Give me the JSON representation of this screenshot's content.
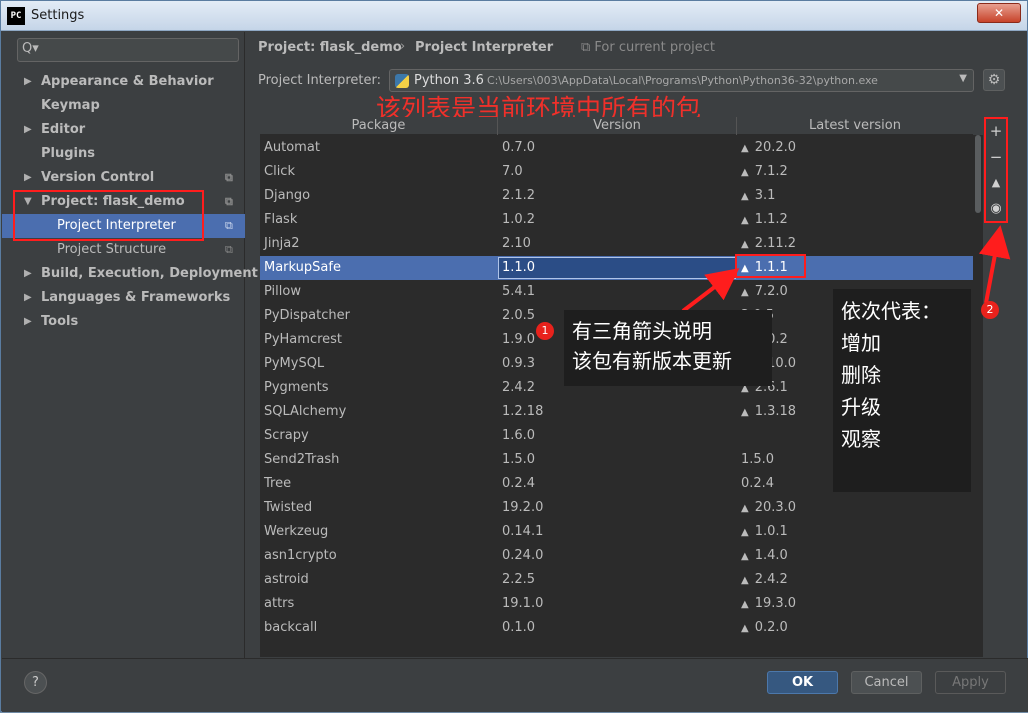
{
  "window": {
    "title": "Settings",
    "app_icon_text": "PC",
    "close_label": "✕"
  },
  "search": {
    "placeholder": "",
    "icon": "search-icon",
    "glyph": "Q▾"
  },
  "sidebar": {
    "items": [
      {
        "label": "Appearance & Behavior",
        "expandable": true
      },
      {
        "label": "Keymap",
        "expandable": false
      },
      {
        "label": "Editor",
        "expandable": true
      },
      {
        "label": "Plugins",
        "expandable": false
      },
      {
        "label": "Version Control",
        "expandable": true
      },
      {
        "label": "Project: flask_demo",
        "expandable": true,
        "expanded": true
      },
      {
        "label": "Project Interpreter",
        "sub": true,
        "selected": true
      },
      {
        "label": "Project Structure",
        "sub": true
      },
      {
        "label": "Build, Execution, Deployment",
        "expandable": true
      },
      {
        "label": "Languages & Frameworks",
        "expandable": true
      },
      {
        "label": "Tools",
        "expandable": true
      }
    ]
  },
  "breadcrumb": {
    "project": "Project: flask_demo",
    "separator": "›",
    "page": "Project Interpreter",
    "scope": "For current project"
  },
  "interpreter": {
    "label": "Project Interpreter:",
    "version": "Python 3.6",
    "path": "C:\\Users\\003\\AppData\\Local\\Programs\\Python\\Python36-32\\python.exe"
  },
  "annotation_top": "该列表是当前环境中所有的包",
  "table": {
    "headers": [
      "Package",
      "Version",
      "Latest version"
    ],
    "rows": [
      {
        "name": "Automat",
        "version": "0.7.0",
        "latest": "20.2.0",
        "upgrade": true
      },
      {
        "name": "Click",
        "version": "7.0",
        "latest": "7.1.2",
        "upgrade": true
      },
      {
        "name": "Django",
        "version": "2.1.2",
        "latest": "3.1",
        "upgrade": true
      },
      {
        "name": "Flask",
        "version": "1.0.2",
        "latest": "1.1.2",
        "upgrade": true
      },
      {
        "name": "Jinja2",
        "version": "2.10",
        "latest": "2.11.2",
        "upgrade": true
      },
      {
        "name": "MarkupSafe",
        "version": "1.1.0",
        "latest": "1.1.1",
        "upgrade": true
      },
      {
        "name": "Pillow",
        "version": "5.4.1",
        "latest": "7.2.0",
        "upgrade": true
      },
      {
        "name": "PyDispatcher",
        "version": "2.0.5",
        "latest": "2.0.5",
        "upgrade": false
      },
      {
        "name": "PyHamcrest",
        "version": "1.9.0",
        "latest": "2.0.2",
        "upgrade": true
      },
      {
        "name": "PyMySQL",
        "version": "0.9.3",
        "latest": "0.10.0",
        "upgrade": true
      },
      {
        "name": "Pygments",
        "version": "2.4.2",
        "latest": "2.6.1",
        "upgrade": true
      },
      {
        "name": "SQLAlchemy",
        "version": "1.2.18",
        "latest": "1.3.18",
        "upgrade": true
      },
      {
        "name": "Scrapy",
        "version": "1.6.0",
        "latest": "",
        "upgrade": false
      },
      {
        "name": "Send2Trash",
        "version": "1.5.0",
        "latest": "1.5.0",
        "upgrade": false
      },
      {
        "name": "Tree",
        "version": "0.2.4",
        "latest": "0.2.4",
        "upgrade": false
      },
      {
        "name": "Twisted",
        "version": "19.2.0",
        "latest": "20.3.0",
        "upgrade": true
      },
      {
        "name": "Werkzeug",
        "version": "0.14.1",
        "latest": "1.0.1",
        "upgrade": true
      },
      {
        "name": "asn1crypto",
        "version": "0.24.0",
        "latest": "1.4.0",
        "upgrade": true
      },
      {
        "name": "astroid",
        "version": "2.2.5",
        "latest": "2.4.2",
        "upgrade": true
      },
      {
        "name": "attrs",
        "version": "19.1.0",
        "latest": "19.3.0",
        "upgrade": true
      },
      {
        "name": "backcall",
        "version": "0.1.0",
        "latest": "0.2.0",
        "upgrade": true
      }
    ],
    "selected_row": 5
  },
  "tools": {
    "add": "+",
    "remove": "−",
    "upgrade": "▲",
    "show": "◉"
  },
  "callout1": {
    "badge": "1",
    "lines": [
      "有三角箭头说明",
      "该包有新版本更新"
    ]
  },
  "callout2": {
    "badge": "2",
    "lines": [
      "依次代表：",
      "增加",
      "删除",
      "升级",
      "观察"
    ]
  },
  "footer": {
    "help": "?",
    "ok": "OK",
    "cancel": "Cancel",
    "apply": "Apply"
  },
  "colors": {
    "accent": "#4b6eaf",
    "annotation_red": "#ff1d1d",
    "background": "#3c3f41"
  }
}
